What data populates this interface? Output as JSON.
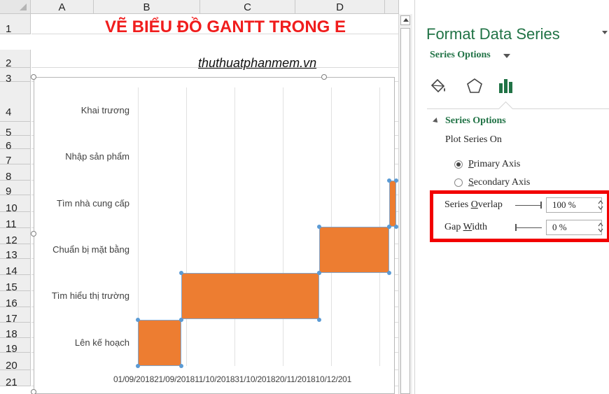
{
  "sheet": {
    "columns": [
      "A",
      "B",
      "C",
      "D"
    ],
    "rows": [
      "1",
      "2",
      "3",
      "4",
      "5",
      "6",
      "7",
      "8",
      "9",
      "10",
      "11",
      "12",
      "13",
      "14",
      "15",
      "16",
      "17",
      "18",
      "19",
      "20",
      "21"
    ],
    "title": "VẼ BIỂU ĐỒ GANTT TRONG E",
    "subtitle": "thuthuatphanmem.vn"
  },
  "chart_data": {
    "type": "bar",
    "orientation": "horizontal",
    "stacked": true,
    "categories": [
      "Khai trương",
      "Nhập sản phẩm",
      "Tìm nhà cung cấp",
      "Chuẩn bị mặt bằng",
      "Tìm hiểu thị trường",
      "Lên kế hoạch"
    ],
    "x_tick_labels": [
      "01/09/2018",
      "21/09/2018",
      "11/10/2018",
      "31/10/2018",
      "20/11/2018",
      "10/12/201"
    ],
    "tasks": [
      {
        "name": "Lên kế hoạch",
        "start": "2018-09-01",
        "end": "2018-09-19"
      },
      {
        "name": "Tìm hiểu thị trường",
        "start": "2018-09-19",
        "end": "2018-11-15"
      },
      {
        "name": "Chuẩn bị mặt bằng",
        "start": "2018-11-15",
        "end": "2018-12-14"
      },
      {
        "name": "Tìm nhà cung cấp",
        "start": "2018-12-14",
        "end": null
      }
    ],
    "bar_color": "#ed7d31",
    "grid": true
  },
  "pane": {
    "title": "Format Data Series",
    "dropdown_label": "Series Options",
    "tabs": [
      {
        "name": "fill-line-icon"
      },
      {
        "name": "effects-icon"
      },
      {
        "name": "series-options-icon"
      }
    ],
    "section_title": "Series Options",
    "plot_series_on": "Plot Series On",
    "primary_axis": {
      "pre": "",
      "key": "P",
      "rest": "rimary Axis"
    },
    "secondary_axis": {
      "pre": "",
      "key": "S",
      "rest": "econdary Axis"
    },
    "series_overlap": {
      "pre": "Series ",
      "key": "O",
      "rest": "verlap",
      "value": "100 %",
      "level": 1.0
    },
    "gap_width": {
      "pre": "Gap ",
      "key": "W",
      "rest": "idth",
      "value": "0 %",
      "level": 0.0
    },
    "highlight_color": "#f20000",
    "accent_color": "#217346"
  }
}
